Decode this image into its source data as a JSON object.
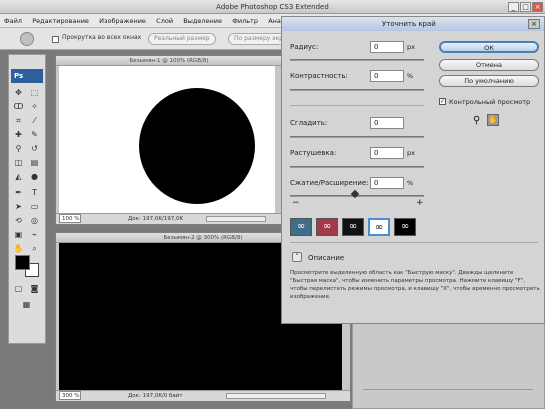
{
  "window": {
    "title": "Adobe Photoshop CS3 Extended"
  },
  "menu": [
    "Файл",
    "Редактирование",
    "Изображение",
    "Слой",
    "Выделение",
    "Фильтр",
    "Анал"
  ],
  "options": {
    "checkbox_label": "Прокрутка во всех окнах",
    "btn_actual": "Реальный размер",
    "btn_fit": "По размеру экрана"
  },
  "toolbox": {
    "logo": "Ps"
  },
  "doc1": {
    "title": "Безымян-1 @ 100% (RGB/8)",
    "zoom": "100 %",
    "status": "Док: 197,0K/197,0K"
  },
  "doc2": {
    "title": "Безымян-2 @ 300% (RGB/8)",
    "zoom": "300 %",
    "status": "Док: 197,0K/0 байт"
  },
  "dialog": {
    "title": "Уточнить край",
    "radius": {
      "label": "Радиус:",
      "value": "0",
      "unit": "px"
    },
    "contrast": {
      "label": "Контрастность:",
      "value": "0",
      "unit": "%"
    },
    "smooth": {
      "label": "Сгладить:",
      "value": "0"
    },
    "feather": {
      "label": "Растушевка:",
      "value": "0",
      "unit": "px"
    },
    "contract": {
      "label": "Сжатие/Расширение:",
      "value": "0",
      "unit": "%",
      "minus": "−",
      "plus": "+"
    },
    "ok": "ОК",
    "cancel": "Отмена",
    "default": "По умолчанию",
    "preview_label": "Контрольный просмотр",
    "description_title": "Описание",
    "description_text": "Просмотрите выделенную область как \"Быструю маску\". Дважды щелкните \"Быстрая маска\", чтобы изменить параметры просмотра. Нажмите клавишу \"F\", чтобы перелистать режимы просмотра, и клавишу \"X\", чтобы временно просмотреть изображение."
  }
}
